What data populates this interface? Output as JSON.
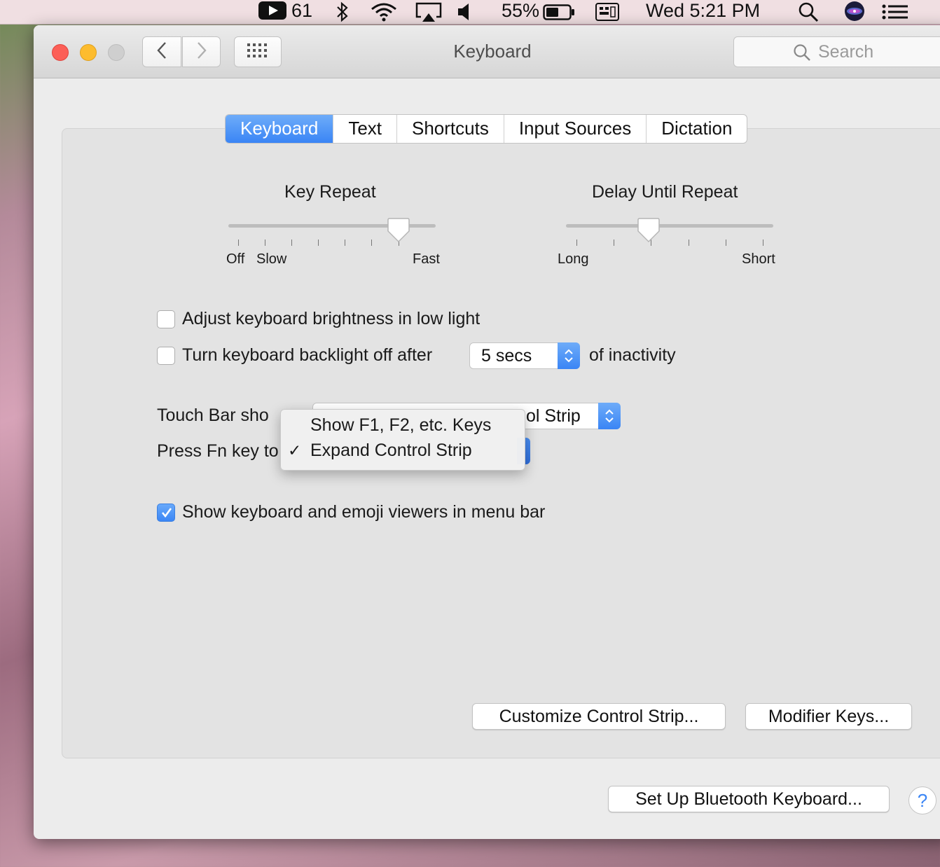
{
  "menubar": {
    "video_count": "61",
    "battery_percent": "55%",
    "clock": "Wed 5:21 PM",
    "icons": [
      "video-icon",
      "bluetooth-icon",
      "wifi-icon",
      "airplay-icon",
      "volume-icon",
      "battery-icon",
      "keyboard-viewer-icon",
      "spotlight-icon",
      "siri-icon",
      "notification-center-icon"
    ]
  },
  "window": {
    "title": "Keyboard",
    "search_placeholder": "Search"
  },
  "tabs": [
    {
      "label": "Keyboard",
      "active": true
    },
    {
      "label": "Text",
      "active": false
    },
    {
      "label": "Shortcuts",
      "active": false
    },
    {
      "label": "Input Sources",
      "active": false
    },
    {
      "label": "Dictation",
      "active": false
    }
  ],
  "key_repeat": {
    "title": "Key Repeat",
    "label_off": "Off",
    "label_slow": "Slow",
    "label_fast": "Fast",
    "value_fraction": 0.82
  },
  "delay_until_repeat": {
    "title": "Delay Until Repeat",
    "label_long": "Long",
    "label_short": "Short",
    "value_fraction": 0.4
  },
  "options": {
    "adjust_brightness": {
      "label": "Adjust keyboard brightness in low light",
      "checked": false
    },
    "backlight_off": {
      "label": "Turn keyboard backlight off after",
      "checked": false,
      "value": "5 secs",
      "suffix": "of inactivity"
    },
    "touch_bar_label": "Touch Bar sho",
    "touch_bar_value_visible": "ol Strip",
    "press_fn_label": "Press Fn key to",
    "show_viewers": {
      "label": "Show keyboard and emoji viewers in menu bar",
      "checked": true
    }
  },
  "dropdown_menu": {
    "items": [
      {
        "label": "Show F1, F2, etc. Keys",
        "checked": false
      },
      {
        "label": "Expand Control Strip",
        "checked": true
      }
    ],
    "checkmark": "✓"
  },
  "buttons": {
    "customize_control_strip": "Customize Control Strip...",
    "modifier_keys": "Modifier Keys...",
    "bluetooth_keyboard": "Set Up Bluetooth Keyboard...",
    "help": "?"
  },
  "colors": {
    "accent": "#3a85f5",
    "close": "#fc5f57",
    "minimize": "#fdbc2e",
    "zoom_disabled": "#cfcfcf"
  }
}
